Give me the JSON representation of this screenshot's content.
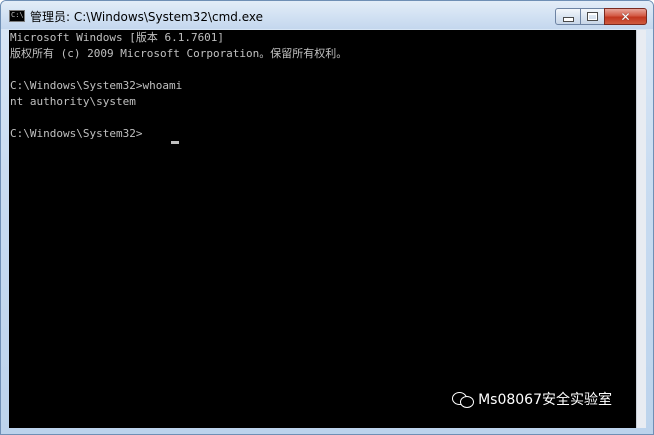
{
  "window": {
    "title": "管理员: C:\\Windows\\System32\\cmd.exe",
    "icon": "console-icon",
    "icon_text": "C:\\",
    "minimize_icon": "minimize-icon",
    "maximize_icon": "maximize-icon",
    "close_icon": "close-icon",
    "close_glyph": "✕"
  },
  "console": {
    "lines": [
      "Microsoft Windows [版本 6.1.7601]",
      "版权所有 (c) 2009 Microsoft Corporation。保留所有权利。",
      "",
      "C:\\Windows\\System32>whoami",
      "nt authority\\system",
      "",
      "C:\\Windows\\System32>"
    ]
  },
  "watermark": {
    "icon": "wechat-icon",
    "text": "Ms08067安全实验室"
  },
  "colors": {
    "console_bg": "#000000",
    "console_text": "#c0c0c0",
    "close_button": "#c2361f"
  }
}
